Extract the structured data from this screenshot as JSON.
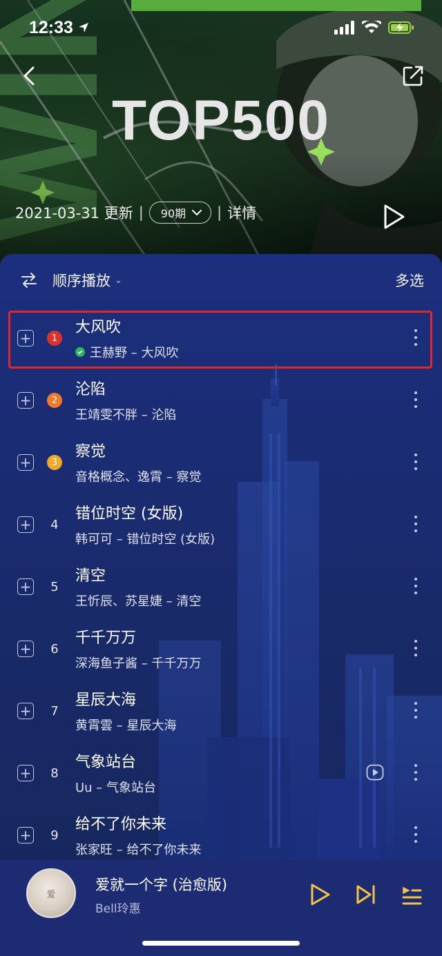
{
  "status": {
    "time": "12:33"
  },
  "header": {
    "title": "TOP500",
    "date_text": "2021-03-31 更新",
    "period_label": "90期",
    "details_label": "详情"
  },
  "list_header": {
    "order_label": "顺序播放",
    "multi_select_label": "多选"
  },
  "songs": [
    {
      "rank": "1",
      "title": "大风吹",
      "subtitle": "王赫野 – 大风吹"
    },
    {
      "rank": "2",
      "title": "沦陷",
      "subtitle": "王靖雯不胖 – 沦陷"
    },
    {
      "rank": "3",
      "title": "察觉",
      "subtitle": "音格概念、逸霄 – 察觉"
    },
    {
      "rank": "4",
      "title": "错位时空 (女版)",
      "subtitle": "韩可可 – 错位时空 (女版)"
    },
    {
      "rank": "5",
      "title": "清空",
      "subtitle": "王忻辰、苏星婕 – 清空"
    },
    {
      "rank": "6",
      "title": "千千万万",
      "subtitle": "深海鱼子酱 – 千千万万"
    },
    {
      "rank": "7",
      "title": "星辰大海",
      "subtitle": "黄霄雲 – 星辰大海"
    },
    {
      "rank": "8",
      "title": "气象站台",
      "subtitle": "Uu – 气象站台"
    },
    {
      "rank": "9",
      "title": "给不了你未来",
      "subtitle": "张家旺 – 给不了你未来"
    }
  ],
  "rank_colors": {
    "1": "#e0302e",
    "2": "#ef7a2a",
    "3": "#f0a92a"
  },
  "accent_color": "#f5c542",
  "highlight_color": "#e3262a",
  "now_playing": {
    "title": "爱就一个字 (治愈版)",
    "artist": "Bell玲惠",
    "cover_text": "爱"
  },
  "icons": [
    "location-arrow-icon",
    "signal-icon",
    "wifi-icon",
    "battery-charging-icon",
    "back-icon",
    "share-icon",
    "chevron-down-icon",
    "play-icon",
    "shuffle-order-icon",
    "add-icon",
    "verified-icon",
    "more-icon",
    "mv-icon",
    "next-icon",
    "playlist-icon"
  ]
}
